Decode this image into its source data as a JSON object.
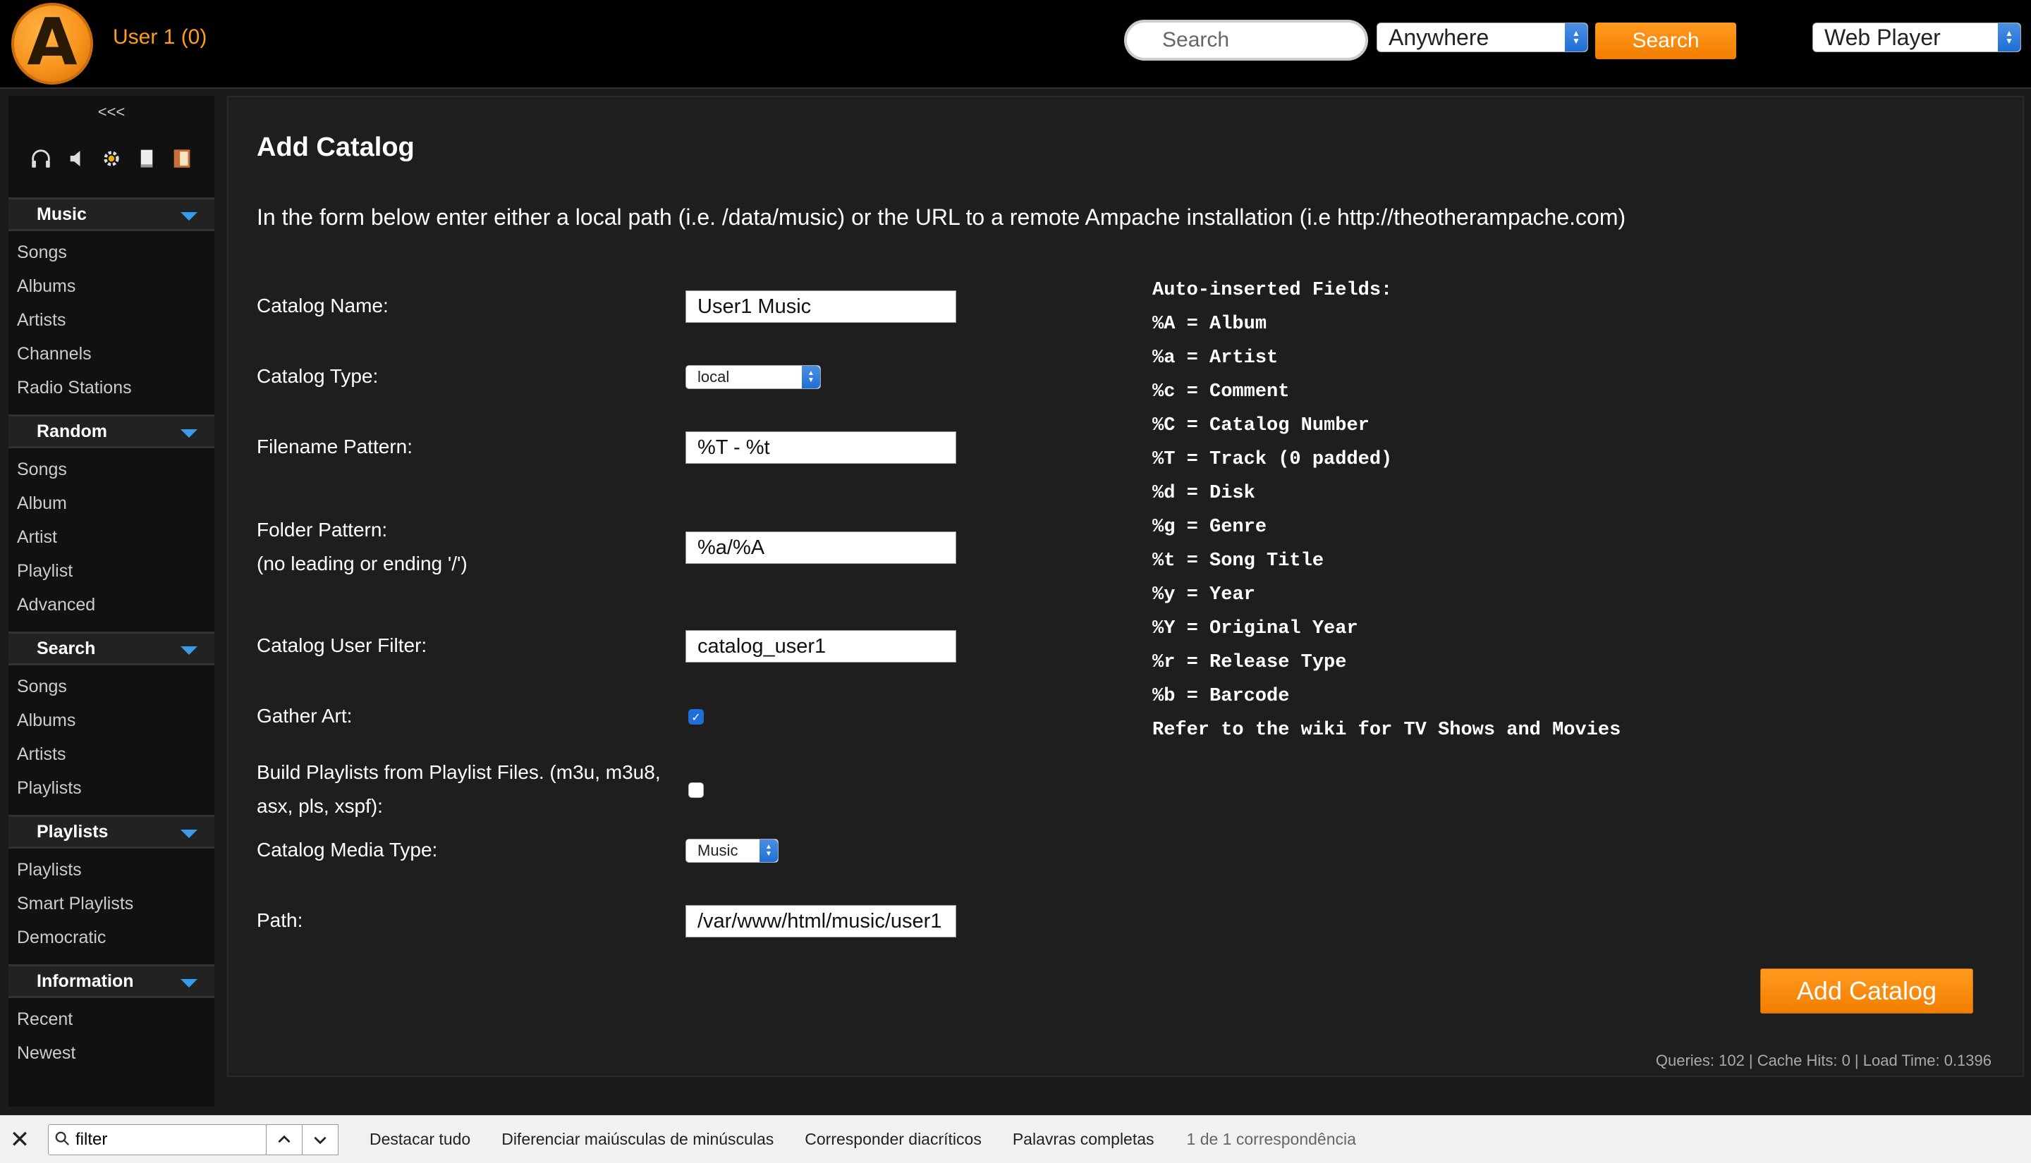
{
  "header": {
    "logo_letter": "A",
    "user_link": "User 1 (0)",
    "search": {
      "placeholder": "Search",
      "scope": "Anywhere",
      "button": "Search"
    },
    "player": "Web Player"
  },
  "sidebar": {
    "collapse": "<<<",
    "icons": [
      "headphones-icon",
      "speaker-icon",
      "gear-icon",
      "document-icon",
      "exit-door-icon"
    ],
    "sections": [
      {
        "title": "Music",
        "items": [
          "Songs",
          "Albums",
          "Artists",
          "Channels",
          "Radio Stations"
        ]
      },
      {
        "title": "Random",
        "items": [
          "Songs",
          "Album",
          "Artist",
          "Playlist",
          "Advanced"
        ]
      },
      {
        "title": "Search",
        "items": [
          "Songs",
          "Albums",
          "Artists",
          "Playlists"
        ]
      },
      {
        "title": "Playlists",
        "items": [
          "Playlists",
          "Smart Playlists",
          "Democratic"
        ]
      },
      {
        "title": "Information",
        "items": [
          "Recent",
          "Newest"
        ]
      }
    ]
  },
  "main": {
    "title": "Add Catalog",
    "intro": "In the form below enter either a local path (i.e. /data/music) or the URL to a remote Ampache installation (i.e http://theotherampache.com)",
    "form": {
      "catalog_name": {
        "label": "Catalog Name:",
        "value": "User1 Music"
      },
      "catalog_type": {
        "label": "Catalog Type:",
        "value": "local"
      },
      "filename_pattern": {
        "label": "Filename Pattern:",
        "value": "%T - %t"
      },
      "folder_pattern": {
        "label": "Folder Pattern:",
        "sublabel": "(no leading or ending '/')",
        "value": "%a/%A"
      },
      "user_filter": {
        "label": "Catalog User Filter:",
        "value": "catalog_user1"
      },
      "gather_art": {
        "label": "Gather Art:",
        "checked": true
      },
      "build_playlists": {
        "label_line1": "Build Playlists from Playlist Files. (m3u, m3u8,",
        "label_line2": "asx, pls, xspf):",
        "checked": false
      },
      "media_type": {
        "label": "Catalog Media Type:",
        "value": "Music"
      },
      "path": {
        "label": "Path:",
        "value": "/var/www/html/music/user1"
      }
    },
    "fields_info": [
      "Auto-inserted Fields:",
      "%A = Album",
      "%a = Artist",
      "%c = Comment",
      "%C = Catalog Number",
      "%T = Track (0 padded)",
      "%d = Disk",
      "%g = Genre",
      "%t = Song Title",
      "%y = Year",
      "%Y = Original Year",
      "%r = Release Type",
      "%b = Barcode",
      "Refer to the wiki for TV Shows and Movies"
    ],
    "submit": "Add Catalog",
    "stats": "Queries: 102 | Cache Hits: 0 | Load Time: 0.1396"
  },
  "findbar": {
    "close_symbol": "✕",
    "query": "filter",
    "highlight_all": "Destacar tudo",
    "match_case": "Diferenciar maiúsculas de minúsculas",
    "match_diacritics": "Corresponder diacríticos",
    "whole_words": "Palavras completas",
    "status": "1 de 1 correspondência"
  }
}
